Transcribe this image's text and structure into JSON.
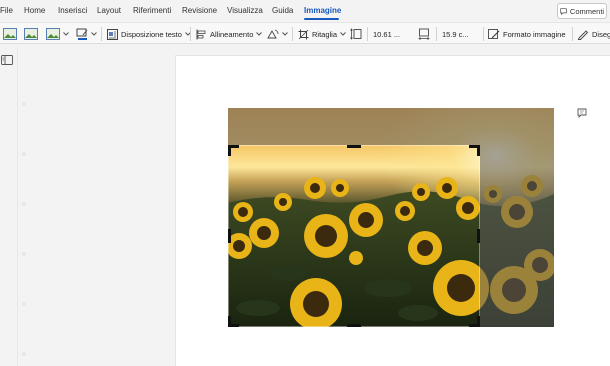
{
  "menu": {
    "tabs": [
      {
        "label": "File"
      },
      {
        "label": "Home"
      },
      {
        "label": "Inserisci"
      },
      {
        "label": "Layout"
      },
      {
        "label": "Riferimenti"
      },
      {
        "label": "Revisione"
      },
      {
        "label": "Visualizza"
      },
      {
        "label": "Guida"
      },
      {
        "label": "Immagine",
        "active": true
      }
    ],
    "comments_label": "Commenti"
  },
  "toolbar": {
    "wrap_text_label": "Disposizione testo",
    "align_label": "Allineamento",
    "crop_label": "Ritaglia",
    "height_value": "10.61 ...",
    "width_value": "15.9 c...",
    "format_label": "Formato immagine",
    "draw_label": "Disegn"
  },
  "colors": {
    "accent": "#185abd",
    "sky_top": "#f2b451",
    "sky_horizon": "#fde79c",
    "foliage": "#2c3a1c",
    "sunflower": "#e8b417"
  },
  "icons": [
    "picture-style-icon",
    "picture-style-icon",
    "picture-style-icon",
    "pen-color-icon",
    "wrap-text-icon",
    "align-icon",
    "rotate-icon",
    "crop-icon",
    "height-icon",
    "width-icon",
    "format-picture-icon",
    "draw-icon",
    "panel-toggle-icon",
    "comment-icon"
  ]
}
